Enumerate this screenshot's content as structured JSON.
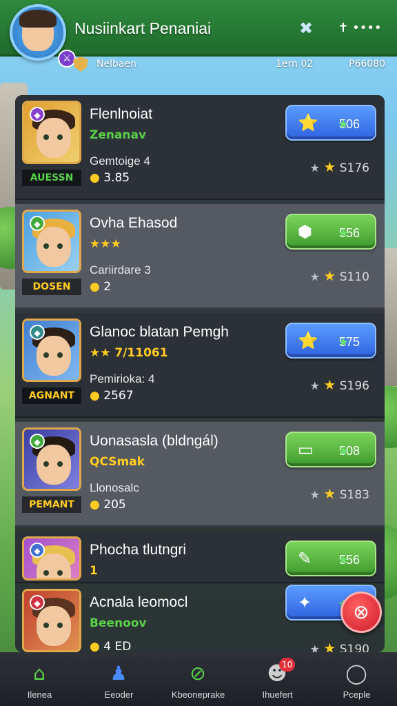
{
  "header": {
    "title": "Nusiinkart Penaniai",
    "avatar_badge_icon": "sword-icon",
    "icons": [
      "shuffle-icon",
      "more-icon"
    ]
  },
  "subbar": {
    "left": "Nelbaen",
    "center": "1ern 02",
    "right": "P66080"
  },
  "rows": [
    {
      "name": "Flenlnoiat",
      "sub": "Zenanav",
      "sub_color": "#5ad04a",
      "tag": "AUESSN",
      "tag_color": "#5ad04a",
      "level": "Gemtoige 4",
      "small": "3.85",
      "button": {
        "label": "506",
        "color": "blue",
        "icon": "⭐"
      },
      "reward": "S176",
      "corner_color": "#8a3fd0",
      "portrait_bg": "linear-gradient(135deg,#e0a030,#f0d070)",
      "hair": "#3a2418"
    },
    {
      "name": "Ovha Ehasod",
      "sub": "★★★",
      "sub_color": "#ffcc22",
      "tag": "DOSEN",
      "tag_color": "#ffcc22",
      "level": "Cariirdare 3",
      "small": "2",
      "button": {
        "label": "556",
        "color": "green",
        "icon": "⬢"
      },
      "reward": "S110",
      "corner_color": "#3faa3a",
      "portrait_bg": "linear-gradient(135deg,#4aa0e0,#9ad0f0)",
      "hair": "#e8b040"
    },
    {
      "name": "Glanoc blatan Pemgh",
      "sub": "★★ 7/11061",
      "sub_color": "#ffcc22",
      "tag": "AGNANT",
      "tag_color": "#ffcc22",
      "level": "Pemirioka: 4",
      "small": "2567",
      "button": {
        "label": "575",
        "color": "blue",
        "icon": "⭐"
      },
      "reward": "S196",
      "corner_color": "#2f8a8a",
      "portrait_bg": "linear-gradient(135deg,#3f7fd0,#80b8f0)",
      "hair": "#2b1f18"
    },
    {
      "name": "Uonasasla (bldngál)",
      "sub": "QCSmak",
      "sub_color": "#ffcc22",
      "tag": "PEMANT",
      "tag_color": "#ffcc22",
      "level": "Llonosalc",
      "small": "205",
      "button": {
        "label": "508",
        "color": "green",
        "icon": "▭"
      },
      "reward": "S183",
      "corner_color": "#3faa3a",
      "portrait_bg": "linear-gradient(135deg,#3a3fa0,#8080e0)",
      "hair": "#241a14"
    },
    {
      "name": "Phocha tlutngri",
      "sub": "1",
      "sub_color": "#ffcc22",
      "tag": "",
      "tag_color": "#ffcc22",
      "level": "",
      "small": "",
      "button": {
        "label": "556",
        "color": "green",
        "icon": "✎"
      },
      "reward": "",
      "corner_color": "#3f6fd0",
      "portrait_bg": "linear-gradient(135deg,#a050d0,#e080c0)",
      "hair": "#e8c050"
    },
    {
      "name": "Acnala leomocl",
      "sub": "Beenoov",
      "sub_color": "#5ad04a",
      "tag": "",
      "tag_color": "#5ad04a",
      "level": "",
      "small": "4 ED",
      "button": {
        "label": "5",
        "color": "blue",
        "icon": "✦"
      },
      "reward": "S190",
      "corner_color": "#d03040",
      "portrait_bg": "linear-gradient(135deg,#c04030,#e09050)",
      "hair": "#5a3420"
    }
  ],
  "fab": {
    "icon": "search-icon"
  },
  "nav": {
    "items": [
      {
        "label": "Ilenea",
        "icon": "home-icon",
        "glyph": "⌂",
        "color": "#5ad04a"
      },
      {
        "label": "Eeoder",
        "icon": "person-icon",
        "glyph": "♟",
        "color": "#4a8aff"
      },
      {
        "label": "Kbeoneprake",
        "icon": "compass-icon",
        "glyph": "⊘",
        "color": "#5ad04a"
      },
      {
        "label": "Ihuefert",
        "icon": "chat-icon",
        "glyph": "☻",
        "color": "#cfcfcf",
        "badge": "10"
      },
      {
        "label": "Pceple",
        "icon": "ring-icon",
        "glyph": "◯",
        "color": "#cfcfcf"
      }
    ]
  }
}
